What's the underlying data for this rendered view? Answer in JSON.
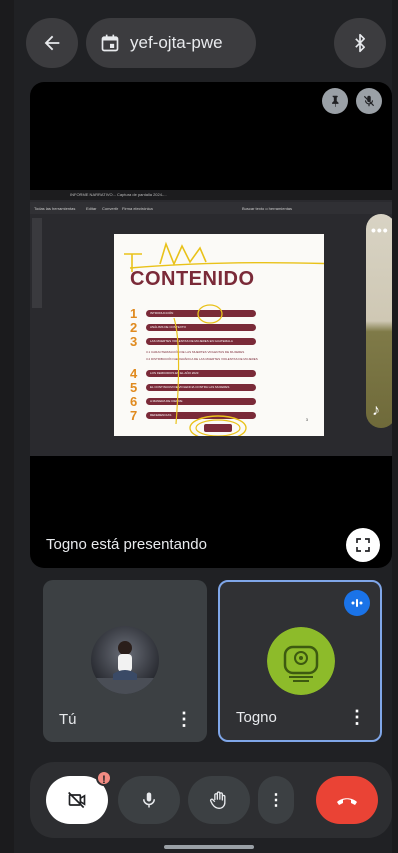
{
  "header": {
    "meeting_code": "yef-ojta-pwe"
  },
  "presentation": {
    "status_text": "Togno está presentando",
    "shared_doc": {
      "browser_tab": "INFORME NARRATIVO...   Captura de pantalla 2024-...",
      "toolbar_items": [
        "Todas las herramientas",
        "Editar",
        "Convertir",
        "Firma electrónica",
        "Buscar texto o herramientas"
      ],
      "title": "CONTENIDO",
      "toc": [
        {
          "num": "1",
          "text": "INTRODUCCIÓN"
        },
        {
          "num": "2",
          "text": "ANÁLISIS DE CONTEXTO"
        },
        {
          "num": "3",
          "text": "LAS MUERTES VIOLENTAS DE MUJERES EN GUATEMALA"
        },
        {
          "num": "4",
          "text": "LOS FEMICIDIOS EN EL AÑO 2023"
        },
        {
          "num": "5",
          "text": "EL CONTINUUM DE VIOLENCIA CONTRA LAS MUJERES"
        },
        {
          "num": "6",
          "text": "A MANERA DE CIERRE"
        },
        {
          "num": "7",
          "text": "REFERENCIAS"
        }
      ],
      "toc_subitems": [
        "3.1  CARACTERIZACIÓN DE LAS MUERTES VIOLENTAS DE MUJERES",
        "3.2  DISTRIBUCIÓN GEOGRÁFICA DE LAS MUERTES VIOLENTAS DE MUJERES"
      ],
      "page_number": "3"
    }
  },
  "participants": [
    {
      "name": "Tú"
    },
    {
      "name": "Togno"
    }
  ],
  "colors": {
    "background": "#202124",
    "end_call": "#ea4335",
    "speaking_border": "#7fa6e8",
    "doc_accent": "#7a2a38",
    "doc_number": "#e08a1e",
    "avatar_green": "#8dbb2a"
  },
  "icons": {
    "back": "arrow-left-icon",
    "calendar": "calendar-icon",
    "bluetooth": "bluetooth-icon",
    "pin": "pin-icon",
    "muted": "mic-off-icon",
    "fullscreen": "fullscreen-icon",
    "camera_off": "video-off-icon",
    "mic": "mic-icon",
    "hand": "raise-hand-icon",
    "more": "more-vert-icon",
    "end": "call-end-icon"
  }
}
